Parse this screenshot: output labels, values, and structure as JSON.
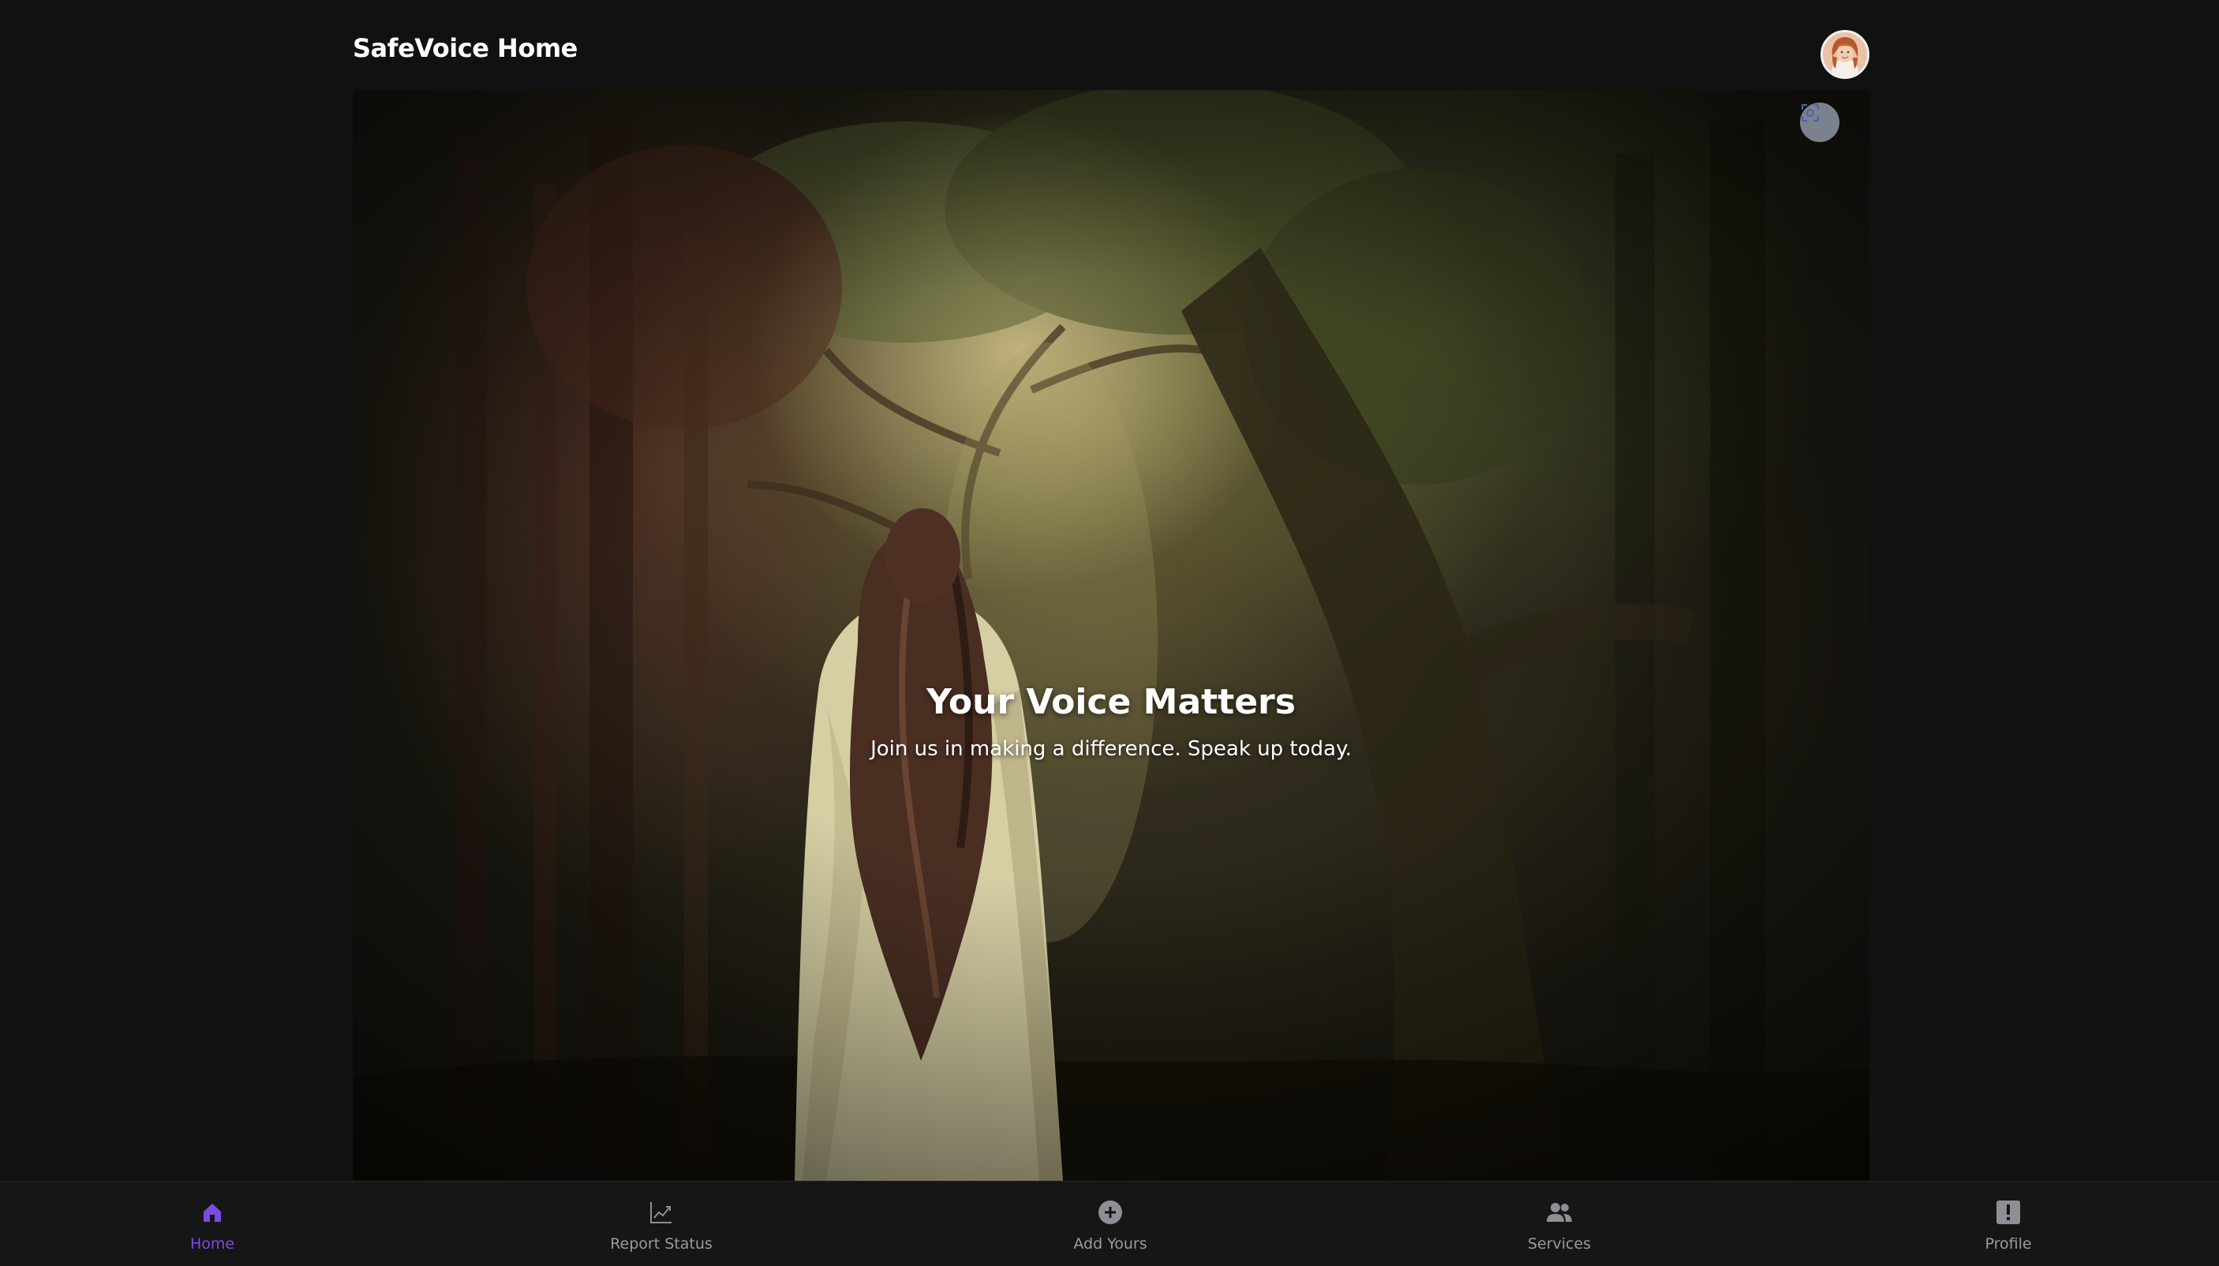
{
  "header": {
    "title": "SafeVoice Home"
  },
  "hero": {
    "title": "Your Voice Matters",
    "subtitle": "Join us in making a difference. Speak up today."
  },
  "bottom_nav": {
    "items": [
      {
        "label": "Home",
        "icon": "home-icon",
        "active": true
      },
      {
        "label": "Report Status",
        "icon": "chart-icon",
        "active": false
      },
      {
        "label": "Add Yours",
        "icon": "plus-circle-icon",
        "active": false
      },
      {
        "label": "Services",
        "icon": "people-icon",
        "active": false
      },
      {
        "label": "Profile",
        "icon": "alert-icon",
        "active": false
      }
    ]
  },
  "colors": {
    "background": "#111112",
    "accent": "#7b4be0",
    "nav_inactive": "#9a9aa0",
    "text": "#ffffff"
  }
}
